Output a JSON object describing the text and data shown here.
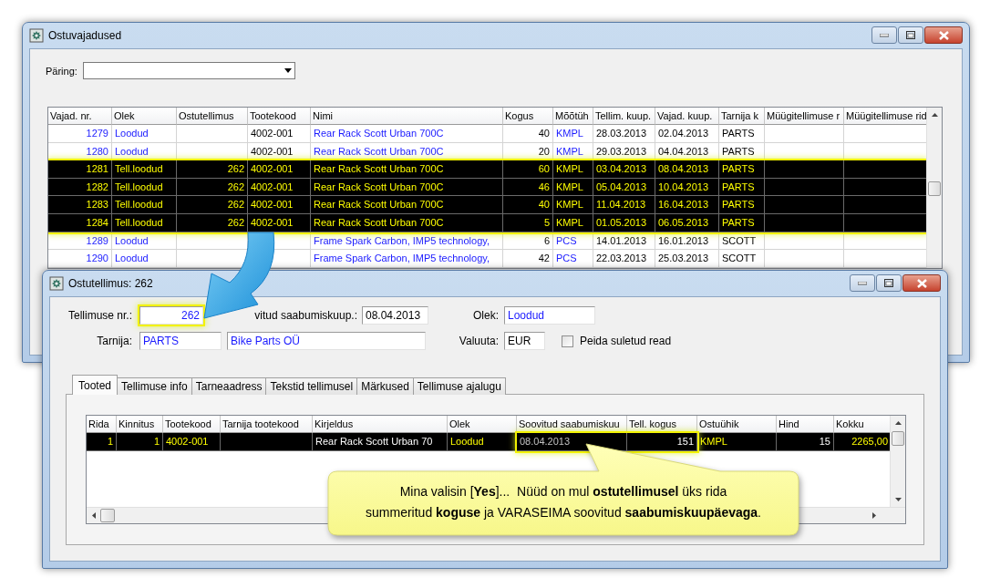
{
  "request_window": {
    "title": "Ostuvajadused",
    "query": {
      "label": "Päring:"
    },
    "table": {
      "columns": [
        {
          "label": "Vajad. nr.",
          "kind": "id"
        },
        {
          "label": "Olek",
          "kind": "link"
        },
        {
          "label": "Ostutellimus",
          "kind": "number"
        },
        {
          "label": "Tootekood",
          "kind": "text"
        },
        {
          "label": "Nimi",
          "kind": "link"
        },
        {
          "label": "Kogus",
          "kind": "number"
        },
        {
          "label": "Mõõtüh",
          "kind": "link"
        },
        {
          "label": "Tellim. kuup.",
          "kind": "text"
        },
        {
          "label": "Vajad. kuup.",
          "kind": "text"
        },
        {
          "label": "Tarnija k",
          "kind": "text"
        },
        {
          "label": "Müügitellimuse r",
          "kind": "text"
        },
        {
          "label": "Müügitellimuse rid",
          "kind": "text"
        }
      ],
      "rows": [
        {
          "selected": false,
          "cells": [
            "1279",
            "Loodud",
            null,
            "4002-001",
            "Rear Rack Scott Urban 700C",
            "40",
            "KMPL",
            "28.03.2013",
            "02.04.2013",
            "PARTS",
            null,
            null
          ]
        },
        {
          "selected": false,
          "cells": [
            "1280",
            "Loodud",
            null,
            "4002-001",
            "Rear Rack Scott Urban 700C",
            "20",
            "KMPL",
            "29.03.2013",
            "04.04.2013",
            "PARTS",
            null,
            null
          ]
        },
        {
          "selected": true,
          "cells": [
            "1281",
            "Tell.loodud",
            "262",
            "4002-001",
            "Rear Rack Scott Urban 700C",
            "60",
            "KMPL",
            "03.04.2013",
            "08.04.2013",
            "PARTS",
            null,
            null
          ]
        },
        {
          "selected": true,
          "cells": [
            "1282",
            "Tell.loodud",
            "262",
            "4002-001",
            "Rear Rack Scott Urban 700C",
            "46",
            "KMPL",
            "05.04.2013",
            "10.04.2013",
            "PARTS",
            null,
            null
          ]
        },
        {
          "selected": true,
          "cells": [
            "1283",
            "Tell.loodud",
            "262",
            "4002-001",
            "Rear Rack Scott Urban 700C",
            "40",
            "KMPL",
            "11.04.2013",
            "16.04.2013",
            "PARTS",
            null,
            null
          ]
        },
        {
          "selected": true,
          "cells": [
            "1284",
            "Tell.loodud",
            "262",
            "4002-001",
            "Rear Rack Scott Urban 700C",
            "5",
            "KMPL",
            "01.05.2013",
            "06.05.2013",
            "PARTS",
            null,
            null
          ]
        },
        {
          "selected": false,
          "cells": [
            "1289",
            "Loodud",
            null,
            null,
            "Frame Spark Carbon, IMP5 technology,",
            "6",
            "PCS",
            "14.01.2013",
            "16.01.2013",
            "SCOTT",
            null,
            null
          ]
        },
        {
          "selected": false,
          "cells": [
            "1290",
            "Loodud",
            null,
            null,
            "Frame Spark Carbon, IMP5 technology,",
            "42",
            "PCS",
            "22.03.2013",
            "25.03.2013",
            "SCOTT",
            null,
            null
          ]
        }
      ]
    }
  },
  "order_window": {
    "title": "Ostutellimus: 262",
    "order_no": {
      "label": "Tellimuse nr.:",
      "value": "262",
      "kind": "lookup",
      "highlighted": true
    },
    "arrival": {
      "label": "vitud saabumiskuup.:",
      "value": "08.04.2013"
    },
    "status": {
      "label": "Olek:",
      "value": "Loodud",
      "kind": "lookup"
    },
    "supplier": {
      "label": "Tarnija:",
      "code": "PARTS",
      "name": "Bike Parts OÜ",
      "kind": "lookup"
    },
    "currency": {
      "label": "Valuuta:",
      "value": "EUR"
    },
    "hide_closed": {
      "label": "Peida suletud read",
      "checked": false
    },
    "tabs": [
      {
        "label": "Tooted",
        "selected": true
      },
      {
        "label": "Tellimuse info",
        "selected": false
      },
      {
        "label": "Tarneaadress",
        "selected": false
      },
      {
        "label": "Tekstid tellimusel",
        "selected": false
      },
      {
        "label": "Märkused",
        "selected": false
      },
      {
        "label": "Tellimuse ajalugu",
        "selected": false
      }
    ],
    "lines": {
      "columns": [
        {
          "label": "Rida"
        },
        {
          "label": "Kinnitus"
        },
        {
          "label": "Tootekood"
        },
        {
          "label": "Tarnija tootekood"
        },
        {
          "label": "Kirjeldus"
        },
        {
          "label": "Olek"
        },
        {
          "label": "Soovitud saabumiskuu"
        },
        {
          "label": "Tell. kogus"
        },
        {
          "label": "Ostuühik"
        },
        {
          "label": "Hind"
        },
        {
          "label": "Kokku"
        }
      ],
      "rows": [
        {
          "selected": true,
          "cells": [
            {
              "text": "1",
              "kind": "number"
            },
            {
              "text": "1",
              "kind": "number"
            },
            {
              "text": "4002-001",
              "kind": "code"
            },
            null,
            {
              "text": "Rear Rack Scott Urban 70",
              "kind": "description"
            },
            {
              "text": "Loodud",
              "kind": "code"
            },
            {
              "text": "08.04.2013",
              "kind": "date",
              "highlighted": true
            },
            {
              "text": "151",
              "kind": "amount",
              "highlighted": true
            },
            {
              "text": "KMPL",
              "kind": "code"
            },
            {
              "text": "15",
              "kind": "amount"
            },
            {
              "text": "2265,00",
              "kind": "number"
            }
          ]
        }
      ]
    }
  },
  "callout": {
    "text": "Mina valisin [**Yes**]...  Nüüd on mul **ostutellimusel** üks rida\nsummeritud **koguse** ja VARASEIMA soovitud **saabumiskuupäevaga**."
  }
}
